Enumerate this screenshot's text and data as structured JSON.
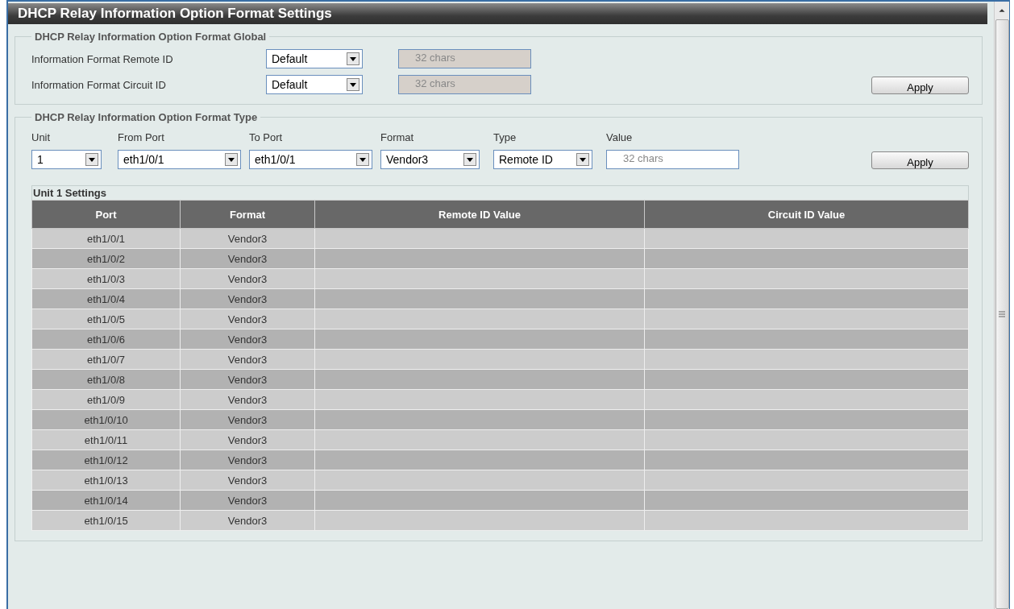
{
  "title": "DHCP Relay Information Option Format Settings",
  "global": {
    "legend": "DHCP Relay Information Option Format Global",
    "rows": [
      {
        "label": "Information Format Remote ID",
        "select": "Default",
        "field": {
          "placeholder": "32 chars",
          "disabled": true
        }
      },
      {
        "label": "Information Format Circuit ID",
        "select": "Default",
        "field": {
          "placeholder": "32 chars",
          "disabled": true
        }
      }
    ],
    "apply": "Apply"
  },
  "type_section": {
    "legend": "DHCP Relay Information Option Format Type",
    "fields": [
      {
        "label": "Unit",
        "kind": "select",
        "value": "1"
      },
      {
        "label": "From Port",
        "kind": "select",
        "value": "eth1/0/1"
      },
      {
        "label": "To Port",
        "kind": "select",
        "value": "eth1/0/1"
      },
      {
        "label": "Format",
        "kind": "select",
        "value": "Vendor3"
      },
      {
        "label": "Type",
        "kind": "select",
        "value": "Remote ID"
      },
      {
        "label": "Value",
        "kind": "input",
        "placeholder": "32 chars"
      }
    ],
    "apply": "Apply"
  },
  "table": {
    "caption": "Unit 1 Settings",
    "columns": [
      "Port",
      "Format",
      "Remote ID Value",
      "Circuit ID Value"
    ],
    "rows": [
      {
        "port": "eth1/0/1",
        "format": "Vendor3"
      },
      {
        "port": "eth1/0/2",
        "format": "Vendor3"
      },
      {
        "port": "eth1/0/3",
        "format": "Vendor3"
      },
      {
        "port": "eth1/0/4",
        "format": "Vendor3"
      },
      {
        "port": "eth1/0/5",
        "format": "Vendor3"
      },
      {
        "port": "eth1/0/6",
        "format": "Vendor3"
      },
      {
        "port": "eth1/0/7",
        "format": "Vendor3"
      },
      {
        "port": "eth1/0/8",
        "format": "Vendor3"
      },
      {
        "port": "eth1/0/9",
        "format": "Vendor3"
      },
      {
        "port": "eth1/0/10",
        "format": "Vendor3"
      },
      {
        "port": "eth1/0/11",
        "format": "Vendor3"
      },
      {
        "port": "eth1/0/12",
        "format": "Vendor3"
      },
      {
        "port": "eth1/0/13",
        "format": "Vendor3"
      },
      {
        "port": "eth1/0/14",
        "format": "Vendor3"
      },
      {
        "port": "eth1/0/15",
        "format": "Vendor3"
      }
    ]
  }
}
